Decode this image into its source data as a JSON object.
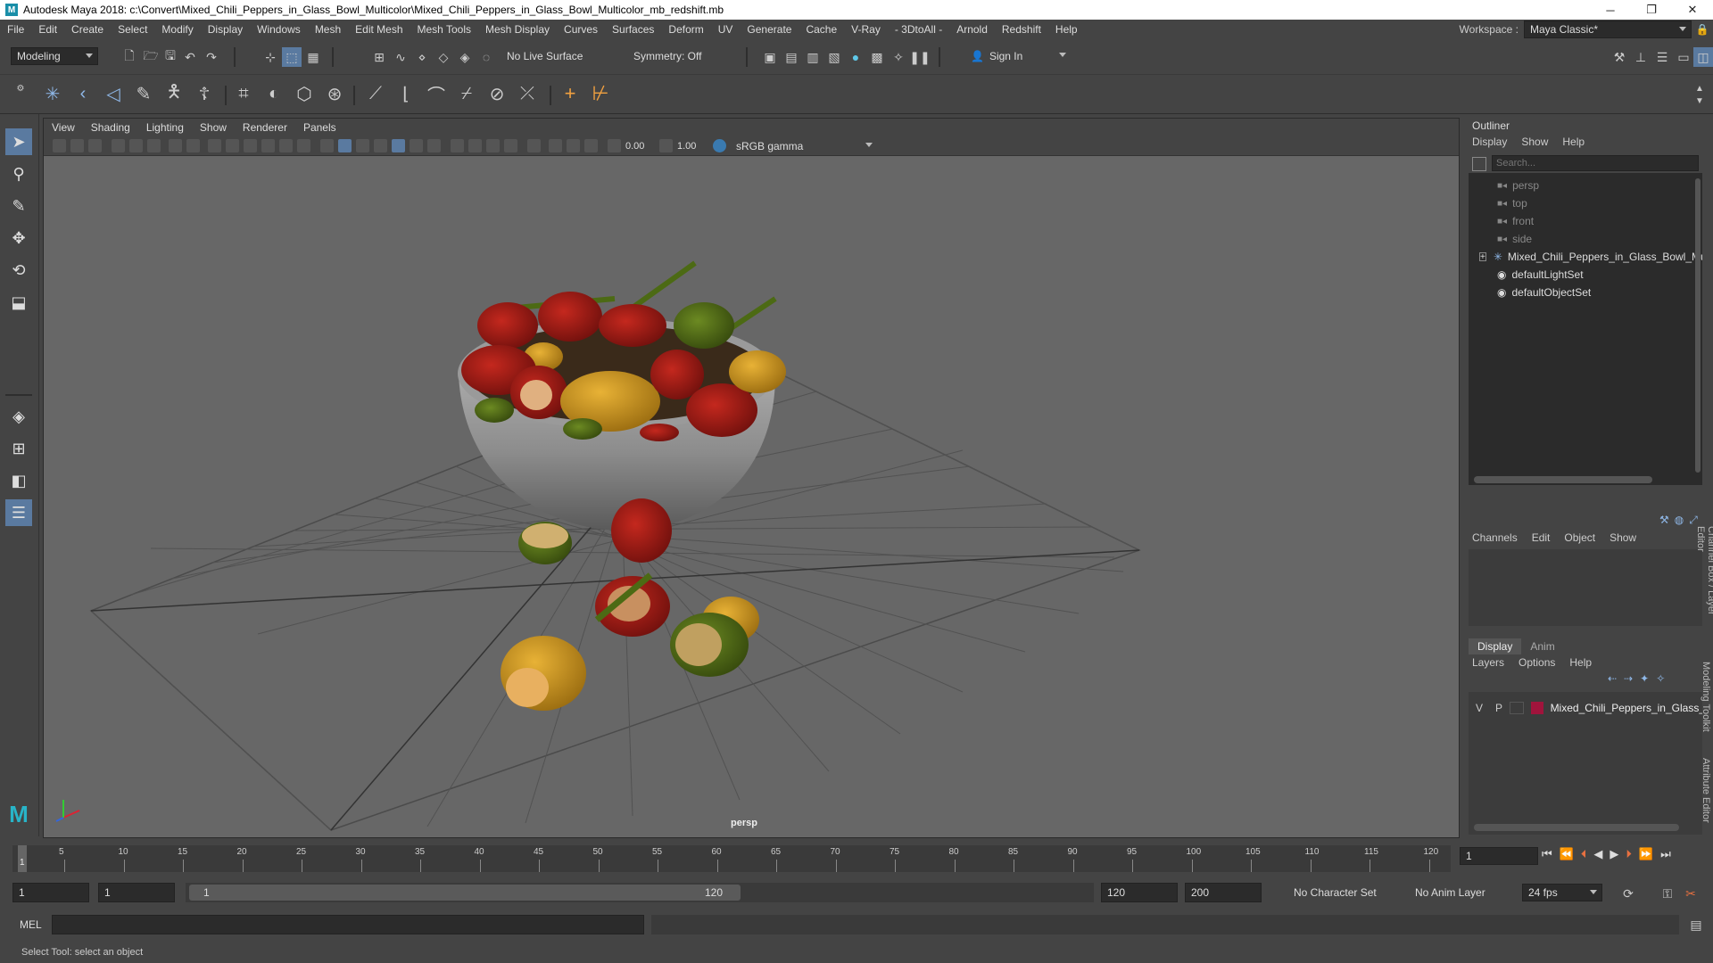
{
  "window": {
    "title": "Autodesk Maya 2018: c:\\Convert\\Mixed_Chili_Peppers_in_Glass_Bowl_Multicolor\\Mixed_Chili_Peppers_in_Glass_Bowl_Multicolor_mb_redshift.mb",
    "minimize": "─",
    "maximize": "❐",
    "close": "✕"
  },
  "menu": [
    "File",
    "Edit",
    "Create",
    "Select",
    "Modify",
    "Display",
    "Windows",
    "Mesh",
    "Edit Mesh",
    "Mesh Tools",
    "Mesh Display",
    "Curves",
    "Surfaces",
    "Deform",
    "UV",
    "Generate",
    "Cache",
    "V-Ray",
    "- 3DtoAll -",
    "Arnold",
    "Redshift",
    "Help"
  ],
  "workspace": {
    "label": "Workspace :",
    "value": "Maya Classic*"
  },
  "statusline": {
    "mode": "Modeling",
    "live_surface": "No Live Surface",
    "symmetry": "Symmetry: Off",
    "sign_in": "Sign In"
  },
  "viewport": {
    "menus": [
      "View",
      "Shading",
      "Lighting",
      "Show",
      "Renderer",
      "Panels"
    ],
    "exposure": "0.00",
    "gamma": "1.00",
    "color_space": "sRGB gamma",
    "camera_label": "persp"
  },
  "outliner": {
    "title": "Outliner",
    "menus": [
      "Display",
      "Show",
      "Help"
    ],
    "search_placeholder": "Search...",
    "items": [
      {
        "label": "persp",
        "icon": "camera-icon",
        "dim": true
      },
      {
        "label": "top",
        "icon": "camera-icon",
        "dim": true
      },
      {
        "label": "front",
        "icon": "camera-icon",
        "dim": true
      },
      {
        "label": "side",
        "icon": "camera-icon",
        "dim": true
      },
      {
        "label": "Mixed_Chili_Peppers_in_Glass_Bowl_Mu",
        "icon": "group-icon",
        "dim": false
      },
      {
        "label": "defaultLightSet",
        "icon": "set-icon",
        "dim": false
      },
      {
        "label": "defaultObjectSet",
        "icon": "set-icon",
        "dim": false
      }
    ]
  },
  "channelbox": {
    "menus": [
      "Channels",
      "Edit",
      "Object",
      "Show"
    ]
  },
  "layers": {
    "tabs": [
      "Display",
      "Anim"
    ],
    "menus": [
      "Layers",
      "Options",
      "Help"
    ],
    "row": {
      "v": "V",
      "p": "P",
      "name": "Mixed_Chili_Peppers_in_Glass_",
      "color": "#a0143c"
    }
  },
  "side_tabs": [
    "Channel Box / Layer Editor",
    "Modeling Toolkit",
    "Attribute Editor"
  ],
  "timeline": {
    "ticks": [
      "5",
      "10",
      "15",
      "20",
      "25",
      "30",
      "35",
      "40",
      "45",
      "50",
      "55",
      "60",
      "65",
      "70",
      "75",
      "80",
      "85",
      "90",
      "95",
      "100",
      "105",
      "110",
      "115",
      "120"
    ],
    "current_frame_marker": "1",
    "current_frame_field": "1"
  },
  "range": {
    "start_a": "1",
    "start_b": "1",
    "slider_start": "1",
    "slider_end": "120",
    "end_a": "120",
    "end_b": "200",
    "character_set": "No Character Set",
    "anim_layer": "No Anim Layer",
    "fps": "24 fps"
  },
  "mel": {
    "label": "MEL"
  },
  "help": {
    "text": "Select Tool: select an object"
  }
}
